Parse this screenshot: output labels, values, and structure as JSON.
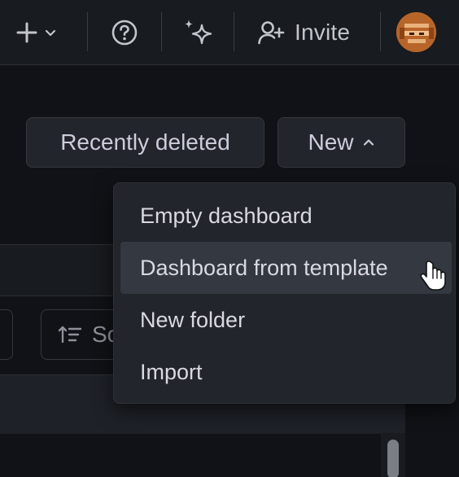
{
  "topbar": {
    "add_icon": "plus-icon",
    "add_caret_icon": "chevron-down-icon",
    "help_icon": "question-circle-icon",
    "ai_icon": "sparkle-icon",
    "invite_icon": "user-plus-icon",
    "invite_label": "Invite",
    "avatar_icon": "user-avatar"
  },
  "header": {
    "recently_deleted_label": "Recently deleted",
    "new_label": "New",
    "new_caret_icon": "chevron-up-icon"
  },
  "filters": {
    "sort_icon": "sort-ascending-icon",
    "sort_label_partial": "So"
  },
  "new_menu": {
    "items": [
      {
        "label": "Empty dashboard"
      },
      {
        "label": "Dashboard from template",
        "hovered": true
      },
      {
        "label": "New folder"
      },
      {
        "label": "Import"
      }
    ]
  },
  "colors": {
    "background": "#111217",
    "panel": "#22252b",
    "menu_hover": "#343840",
    "text": "#ccccdc",
    "avatar": "#b8652a"
  }
}
